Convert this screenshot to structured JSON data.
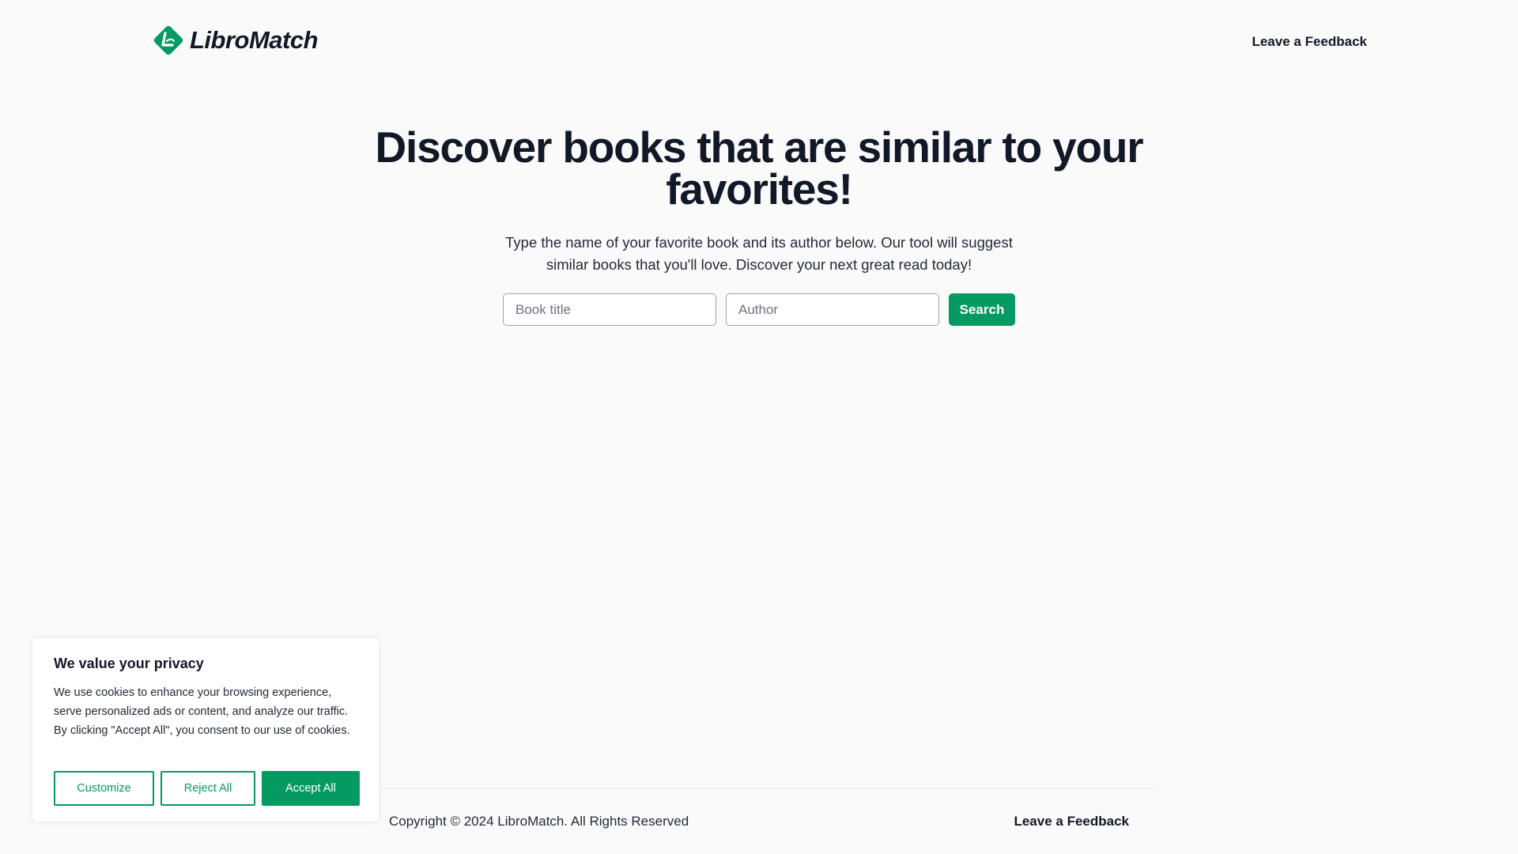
{
  "colors": {
    "accent": "#059a62",
    "text": "#111827",
    "background": "#fafafa"
  },
  "header": {
    "brand_name": "LibroMatch",
    "logo_icon": "book-diamond-icon",
    "feedback_link": "Leave a Feedback"
  },
  "hero": {
    "title": "Discover books that are similar to your favorites!",
    "subtitle": "Type the name of your favorite book and its author below. Our tool will suggest similar books that you'll love. Discover your next great read today!"
  },
  "search": {
    "title_placeholder": "Book title",
    "title_value": "",
    "author_placeholder": "Author",
    "author_value": "",
    "button_label": "Search"
  },
  "footer": {
    "copyright": "Copyright © 2024 LibroMatch. All Rights Reserved",
    "feedback_link": "Leave a Feedback"
  },
  "cookie_banner": {
    "title": "We value your privacy",
    "text": "We use cookies to enhance your browsing experience, serve personalized ads or content, and analyze our traffic. By clicking \"Accept All\", you consent to our use of cookies.",
    "customize_label": "Customize",
    "reject_label": "Reject All",
    "accept_label": "Accept All"
  }
}
